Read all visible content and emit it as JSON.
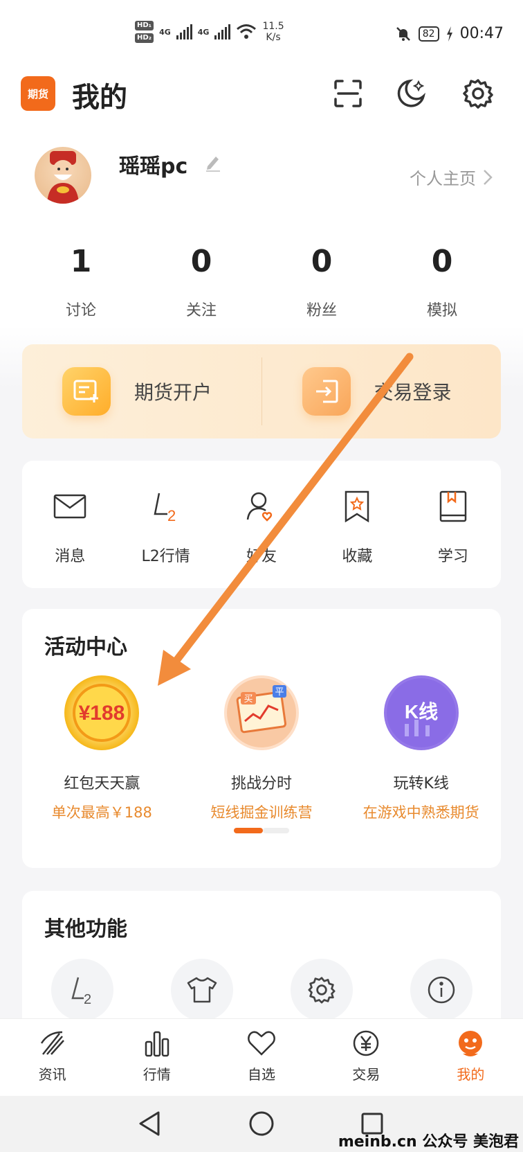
{
  "status_bar": {
    "hd1": "HD₁",
    "hd2": "HD₂",
    "net1": "4G",
    "net2": "4G",
    "speed_value": "11.5",
    "speed_unit": "K/s",
    "battery": "82",
    "time": "00:47"
  },
  "header": {
    "logo_text": "期货",
    "title": "我的",
    "icons": [
      "scan-icon",
      "moon-icon",
      "gear-icon"
    ]
  },
  "profile": {
    "username": "瑶瑶pc",
    "homepage_label": "个人主页"
  },
  "stats": [
    {
      "value": "1",
      "label": "讨论"
    },
    {
      "value": "0",
      "label": "关注"
    },
    {
      "value": "0",
      "label": "粉丝"
    },
    {
      "value": "0",
      "label": "模拟"
    }
  ],
  "account_card": {
    "open_label": "期货开户",
    "login_label": "交易登录"
  },
  "quick_menu": [
    {
      "label": "消息",
      "icon": "envelope-icon"
    },
    {
      "label": "L2行情",
      "icon": "l2-icon"
    },
    {
      "label": "好友",
      "icon": "friend-icon"
    },
    {
      "label": "收藏",
      "icon": "bookmark-star-icon"
    },
    {
      "label": "学习",
      "icon": "book-icon"
    }
  ],
  "activity": {
    "title": "活动中心",
    "items": [
      {
        "title": "红包天天赢",
        "subtitle": "单次最高￥188",
        "badge": "¥188"
      },
      {
        "title": "挑战分时",
        "subtitle": "短线掘金训练营",
        "badge_buy": "买",
        "badge_flat": "平"
      },
      {
        "title": "玩转K线",
        "subtitle": "在游戏中熟悉期货",
        "badge": "K线"
      }
    ]
  },
  "other": {
    "title": "其他功能",
    "icons": [
      "l2-icon",
      "tshirt-icon",
      "gear-icon",
      "info-icon"
    ]
  },
  "bottom_nav": [
    {
      "label": "资讯",
      "icon": "news-icon"
    },
    {
      "label": "行情",
      "icon": "bar-chart-icon"
    },
    {
      "label": "自选",
      "icon": "heart-icon"
    },
    {
      "label": "交易",
      "icon": "yen-icon"
    },
    {
      "label": "我的",
      "icon": "mascot-icon",
      "active": true
    }
  ],
  "watermark": "meinb.cn  公众号 美泡君",
  "colors": {
    "accent": "#f26a1b",
    "annotation_arrow": "#f28c3c",
    "subtitle": "#e88a2e"
  }
}
